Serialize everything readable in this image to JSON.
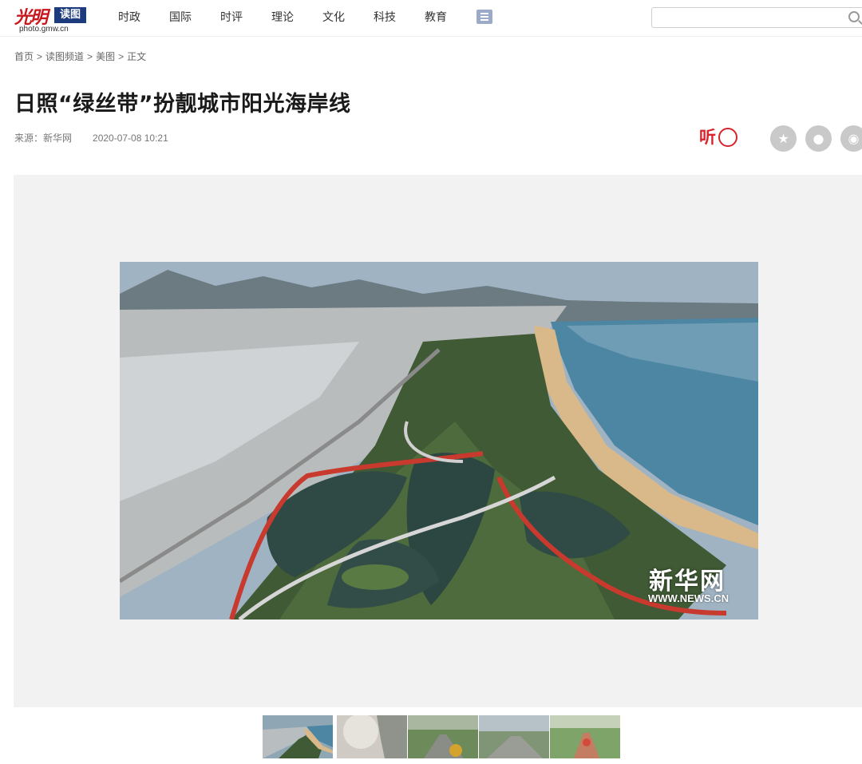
{
  "header": {
    "logo_mark": "光明",
    "logo_badge": "读图",
    "logo_domain": "photo.gmw.cn",
    "nav": [
      "时政",
      "国际",
      "时评",
      "理论",
      "文化",
      "科技",
      "教育"
    ],
    "menu_icon": "list-icon",
    "search": {
      "value": "",
      "placeholder": "",
      "icon": "search-icon"
    }
  },
  "breadcrumb": {
    "items": [
      "首页",
      "读图频道",
      "美图",
      "正文"
    ],
    "separator": ">"
  },
  "article": {
    "title": "日照“绿丝带”扮靓城市阳光海岸线",
    "source": "来源：新华网",
    "date": "2020-07-08 10:21",
    "listen_label": "听",
    "share_icons": [
      "star-icon",
      "wechat-icon",
      "weibo-icon"
    ]
  },
  "photo": {
    "watermark_cn": "新华网",
    "watermark_url": "WWW.NEWS.CN"
  },
  "thumbnails": {
    "count": 5,
    "active_index": 0
  },
  "colors": {
    "brand_red": "#c8161d",
    "brand_blue": "#1d3c7f",
    "listen_red": "#d8232a",
    "gallery_bg": "#f2f2f2"
  }
}
